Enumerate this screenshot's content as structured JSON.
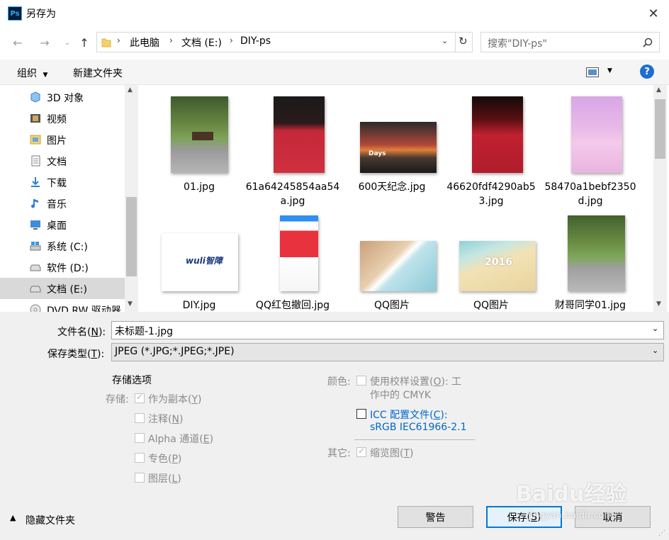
{
  "window": {
    "title": "另存为",
    "app_icon_text": "Ps",
    "close_icon": "close-icon"
  },
  "address": {
    "crumbs": [
      "此电脑",
      "文档 (E:)",
      "DIY-ps"
    ]
  },
  "search": {
    "placeholder": "搜索\"DIY-ps\""
  },
  "toolbar": {
    "organize": "组织",
    "new_folder": "新建文件夹",
    "help": "?"
  },
  "nav": {
    "items": [
      {
        "label": "3D 对象",
        "icon": "3d-objects-icon"
      },
      {
        "label": "视频",
        "icon": "video-icon"
      },
      {
        "label": "图片",
        "icon": "pictures-icon"
      },
      {
        "label": "文档",
        "icon": "documents-icon"
      },
      {
        "label": "下载",
        "icon": "downloads-icon"
      },
      {
        "label": "音乐",
        "icon": "music-icon"
      },
      {
        "label": "桌面",
        "icon": "desktop-icon"
      },
      {
        "label": "系统 (C:)",
        "icon": "drive-icon"
      },
      {
        "label": "软件 (D:)",
        "icon": "drive-icon"
      },
      {
        "label": "文档 (E:)",
        "icon": "drive-icon",
        "selected": true
      },
      {
        "label": "DVD RW 驱动器",
        "icon": "dvd-icon"
      }
    ]
  },
  "files": [
    {
      "name": "01.jpg"
    },
    {
      "name": "61a64245854aa54a.jpg"
    },
    {
      "name": "600天纪念.jpg",
      "thumb_text": "Days"
    },
    {
      "name": "46620fdf4290ab53.jpg"
    },
    {
      "name": "58470a1bebf2350d.jpg"
    },
    {
      "name": "DIY.jpg",
      "thumb_text": "wuli智障"
    },
    {
      "name": "QQ红包撤回.jpg"
    },
    {
      "name": "QQ图片"
    },
    {
      "name": "QQ图片",
      "thumb_text": "2016"
    },
    {
      "name": "财哥同学01.jpg"
    }
  ],
  "form": {
    "filename_label": "文件名",
    "filename_hotkey": "N",
    "filename_value": "未标题-1.jpg",
    "filetype_label": "保存类型",
    "filetype_hotkey": "T",
    "filetype_value": "JPEG (*.JPG;*.JPEG;*.JPE)"
  },
  "storage": {
    "heading": "存储选项",
    "save_label": "存储:",
    "options": [
      {
        "label": "作为副本",
        "hotkey": "Y",
        "checked": true
      },
      {
        "label": "注释",
        "hotkey": "N",
        "checked": false
      },
      {
        "label": "Alpha 通道",
        "hotkey": "E",
        "checked": false
      },
      {
        "label": "专色",
        "hotkey": "P",
        "checked": false
      },
      {
        "label": "图层",
        "hotkey": "L",
        "checked": false
      }
    ]
  },
  "color": {
    "label": "颜色:",
    "proof_line1": "使用校样设置",
    "proof_hotkey": "O",
    "proof_tail": ": 工",
    "proof_line2": "作中的 CMYK",
    "icc_label": "ICC 配置文件",
    "icc_hotkey": "C",
    "icc_profile": "sRGB IEC61966-2.1",
    "accent": "#0066cc"
  },
  "other": {
    "label": "其它:",
    "thumbnail": "缩览图",
    "thumbnail_hotkey": "T",
    "checked": true
  },
  "footer": {
    "hide_folders": "隐藏文件夹",
    "warning": "警告",
    "save": "保存",
    "save_hotkey": "S",
    "cancel": "取消"
  },
  "watermark": {
    "text": "Baidu经验",
    "url": "jingyan.baidu.com"
  }
}
